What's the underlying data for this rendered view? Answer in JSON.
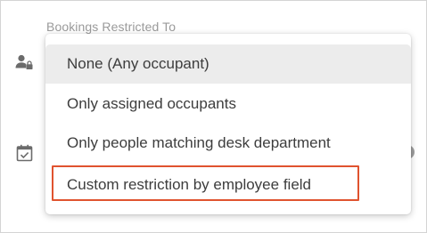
{
  "field": {
    "label": "Bookings Restricted To"
  },
  "icons": {
    "restriction": "person-lock-icon",
    "booking": "calendar-check-icon"
  },
  "dropdown": {
    "selected_index": 0,
    "highlighted_index": 3,
    "options": [
      {
        "label": "None (Any occupant)"
      },
      {
        "label": "Only assigned occupants"
      },
      {
        "label": "Only people matching desk department"
      },
      {
        "label": "Custom restriction by employee field"
      }
    ]
  },
  "colors": {
    "highlight_border": "#e0532f",
    "hover_background": "#ececec",
    "option_text": "#3d3d3d",
    "label_text": "#9a9a9a"
  }
}
